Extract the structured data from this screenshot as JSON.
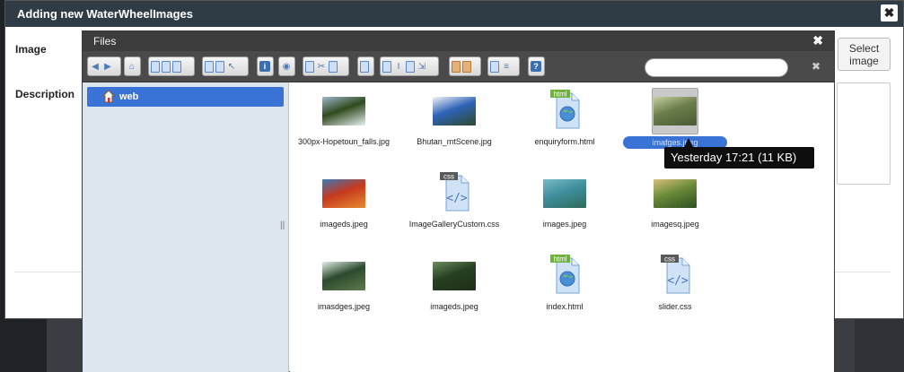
{
  "outer_dialog": {
    "title": "Adding new WaterWheelImages",
    "close_label": "✖",
    "image_label": "Image",
    "description_label": "Description",
    "select_image_label": "Select image"
  },
  "file_manager": {
    "title": "Files",
    "close_label": "✖",
    "search_placeholder": "",
    "search_clear": "✖",
    "tree": [
      {
        "label": "web"
      }
    ],
    "files": [
      {
        "name": "300px-Hopetoun_falls.jpg",
        "kind": "image",
        "colors": [
          "#2f4a1e",
          "#9fb7c9",
          "#e8f0ef"
        ]
      },
      {
        "name": "Bhutan_mtScene.jpg",
        "kind": "image",
        "colors": [
          "#2f63b8",
          "#f3f5f7",
          "#2e4a2a"
        ]
      },
      {
        "name": "enquiryform.html",
        "kind": "html",
        "badge": "html"
      },
      {
        "name": "imafges.jpeg",
        "kind": "image",
        "colors": [
          "#6a7d4a",
          "#c6d0a0",
          "#4a5a36"
        ],
        "selected": true
      },
      {
        "name": "imageds.jpeg",
        "kind": "image",
        "colors": [
          "#c6391f",
          "#3e78b6",
          "#e58a2f"
        ]
      },
      {
        "name": "ImageGalleryCustom.css",
        "kind": "css",
        "badge": "css"
      },
      {
        "name": "images.jpeg",
        "kind": "image",
        "colors": [
          "#3f8f9f",
          "#79b9c2",
          "#2f6a58"
        ]
      },
      {
        "name": "imagesq.jpeg",
        "kind": "image",
        "colors": [
          "#6a8a3a",
          "#d8c07a",
          "#2d4f22"
        ]
      },
      {
        "name": "imasdges.jpeg",
        "kind": "image",
        "colors": [
          "#2c4a2e",
          "#e2eee6",
          "#5f7a4c"
        ]
      },
      {
        "name": "imageds.jpeg",
        "kind": "image",
        "colors": [
          "#263f22",
          "#6e8d5c",
          "#1f2f18"
        ]
      },
      {
        "name": "index.html",
        "kind": "html",
        "badge": "html"
      },
      {
        "name": "slider.css",
        "kind": "css",
        "badge": "css"
      }
    ]
  },
  "tooltip": {
    "text": "Yesterday 17:21 (11 KB)"
  }
}
